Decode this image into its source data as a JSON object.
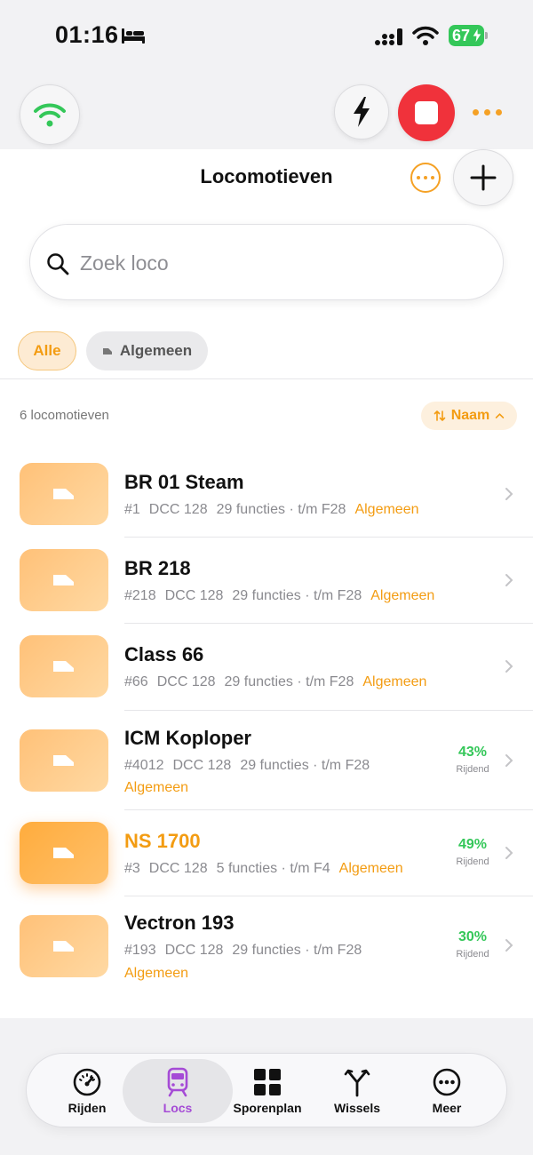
{
  "status": {
    "time": "01:16",
    "battery": "67"
  },
  "header": {
    "title": "Locomotieven"
  },
  "search": {
    "placeholder": "Zoek loco"
  },
  "filters": [
    {
      "label": "Alle"
    },
    {
      "label": "Algemeen"
    }
  ],
  "list": {
    "count": "6 locomotieven",
    "sort_label": "Naam",
    "items": [
      {
        "name": "BR 01 Steam",
        "address": "#1",
        "protocol": "DCC 128",
        "functions": "29 functies · t/m F28",
        "group": "Algemeen",
        "speed": "",
        "speed_label": ""
      },
      {
        "name": "BR 218",
        "address": "#218",
        "protocol": "DCC 128",
        "functions": "29 functies · t/m F28",
        "group": "Algemeen",
        "speed": "",
        "speed_label": ""
      },
      {
        "name": "Class 66",
        "address": "#66",
        "protocol": "DCC 128",
        "functions": "29 functies · t/m F28",
        "group": "Algemeen",
        "speed": "",
        "speed_label": ""
      },
      {
        "name": "ICM Koploper",
        "address": "#4012",
        "protocol": "DCC 128",
        "functions": "29 functies · t/m F28",
        "group": "Algemeen",
        "speed": "43%",
        "speed_label": "Rijdend"
      },
      {
        "name": "NS 1700",
        "address": "#3",
        "protocol": "DCC 128",
        "functions": "5 functies · t/m F4",
        "group": "Algemeen",
        "speed": "49%",
        "speed_label": "Rijdend"
      },
      {
        "name": "Vectron 193",
        "address": "#193",
        "protocol": "DCC 128",
        "functions": "29 functies · t/m F28",
        "group": "Algemeen",
        "speed": "30%",
        "speed_label": "Rijdend"
      }
    ]
  },
  "tabs": [
    {
      "label": "Rijden",
      "icon": "speedometer-icon"
    },
    {
      "label": "Locs",
      "icon": "train-icon"
    },
    {
      "label": "Sporenplan",
      "icon": "grid-icon"
    },
    {
      "label": "Wissels",
      "icon": "switch-fork-icon"
    },
    {
      "label": "Meer",
      "icon": "more-icon"
    }
  ],
  "colors": {
    "accent": "#f39c12",
    "stop": "#f0323b",
    "connected": "#34c759",
    "active_tab": "#a54bd6"
  }
}
